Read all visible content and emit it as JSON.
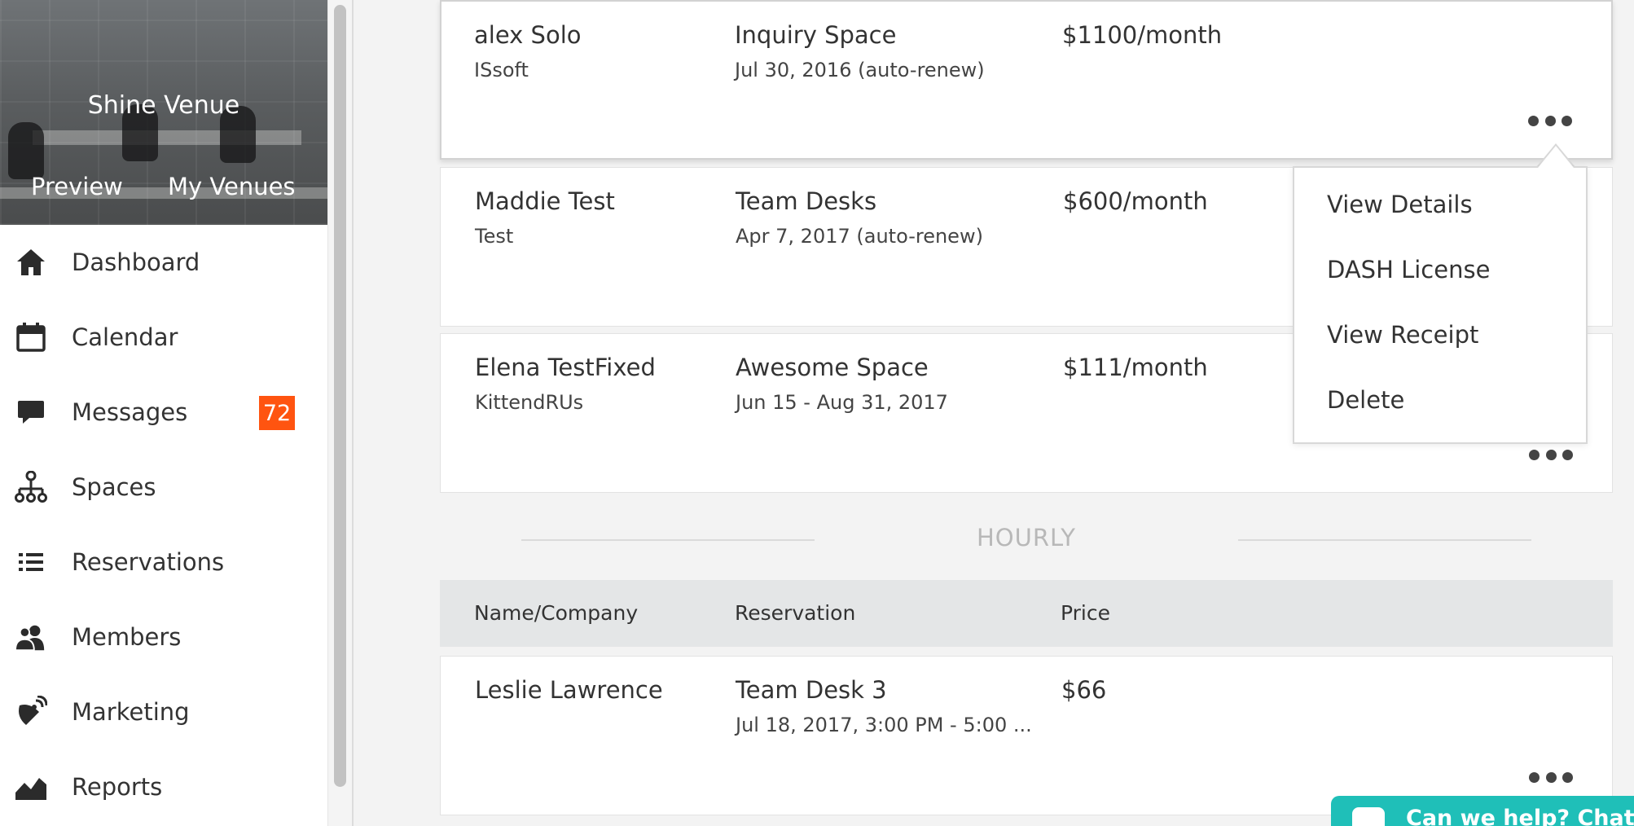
{
  "venue": {
    "name": "Shine Venue",
    "preview_label": "Preview",
    "my_venues_label": "My Venues"
  },
  "nav": {
    "items": [
      {
        "label": "Dashboard",
        "icon": "home-icon"
      },
      {
        "label": "Calendar",
        "icon": "calendar-icon"
      },
      {
        "label": "Messages",
        "icon": "message-icon"
      },
      {
        "label": "Spaces",
        "icon": "spaces-icon"
      },
      {
        "label": "Reservations",
        "icon": "list-icon"
      },
      {
        "label": "Members",
        "icon": "members-icon"
      },
      {
        "label": "Marketing",
        "icon": "marketing-icon"
      },
      {
        "label": "Reports",
        "icon": "reports-icon"
      }
    ],
    "messages_badge": "72"
  },
  "monthly": [
    {
      "name": "alex Solo",
      "company": "ISsoft",
      "space": "Inquiry Space",
      "dates": "Jul 30, 2016 (auto-renew)",
      "price": "$1100/month"
    },
    {
      "name": "Maddie Test",
      "company": "Test",
      "space": "Team Desks",
      "dates": "Apr 7, 2017 (auto-renew)",
      "price": "$600/month"
    },
    {
      "name": "Elena TestFixed",
      "company": "KittendRUs",
      "space": "Awesome Space",
      "dates": "Jun 15 - Aug 31, 2017",
      "price": "$111/month"
    }
  ],
  "hourly": {
    "title": "HOURLY",
    "columns": {
      "name": "Name/Company",
      "reservation": "Reservation",
      "price": "Price"
    },
    "rows": [
      {
        "name": "Leslie Lawrence",
        "space": "Team Desk 3",
        "dates": "Jul 18, 2017, 3:00 PM - 5:00 ...",
        "price": "$66"
      }
    ]
  },
  "dropdown": {
    "items": [
      "View Details",
      "DASH License",
      "View Receipt",
      "Delete"
    ]
  },
  "chat": {
    "label": "Can we help? Chat no"
  },
  "colors": {
    "badge": "#ff5410",
    "chat": "#1fbfb8",
    "table_header": "#e4e6e7"
  }
}
